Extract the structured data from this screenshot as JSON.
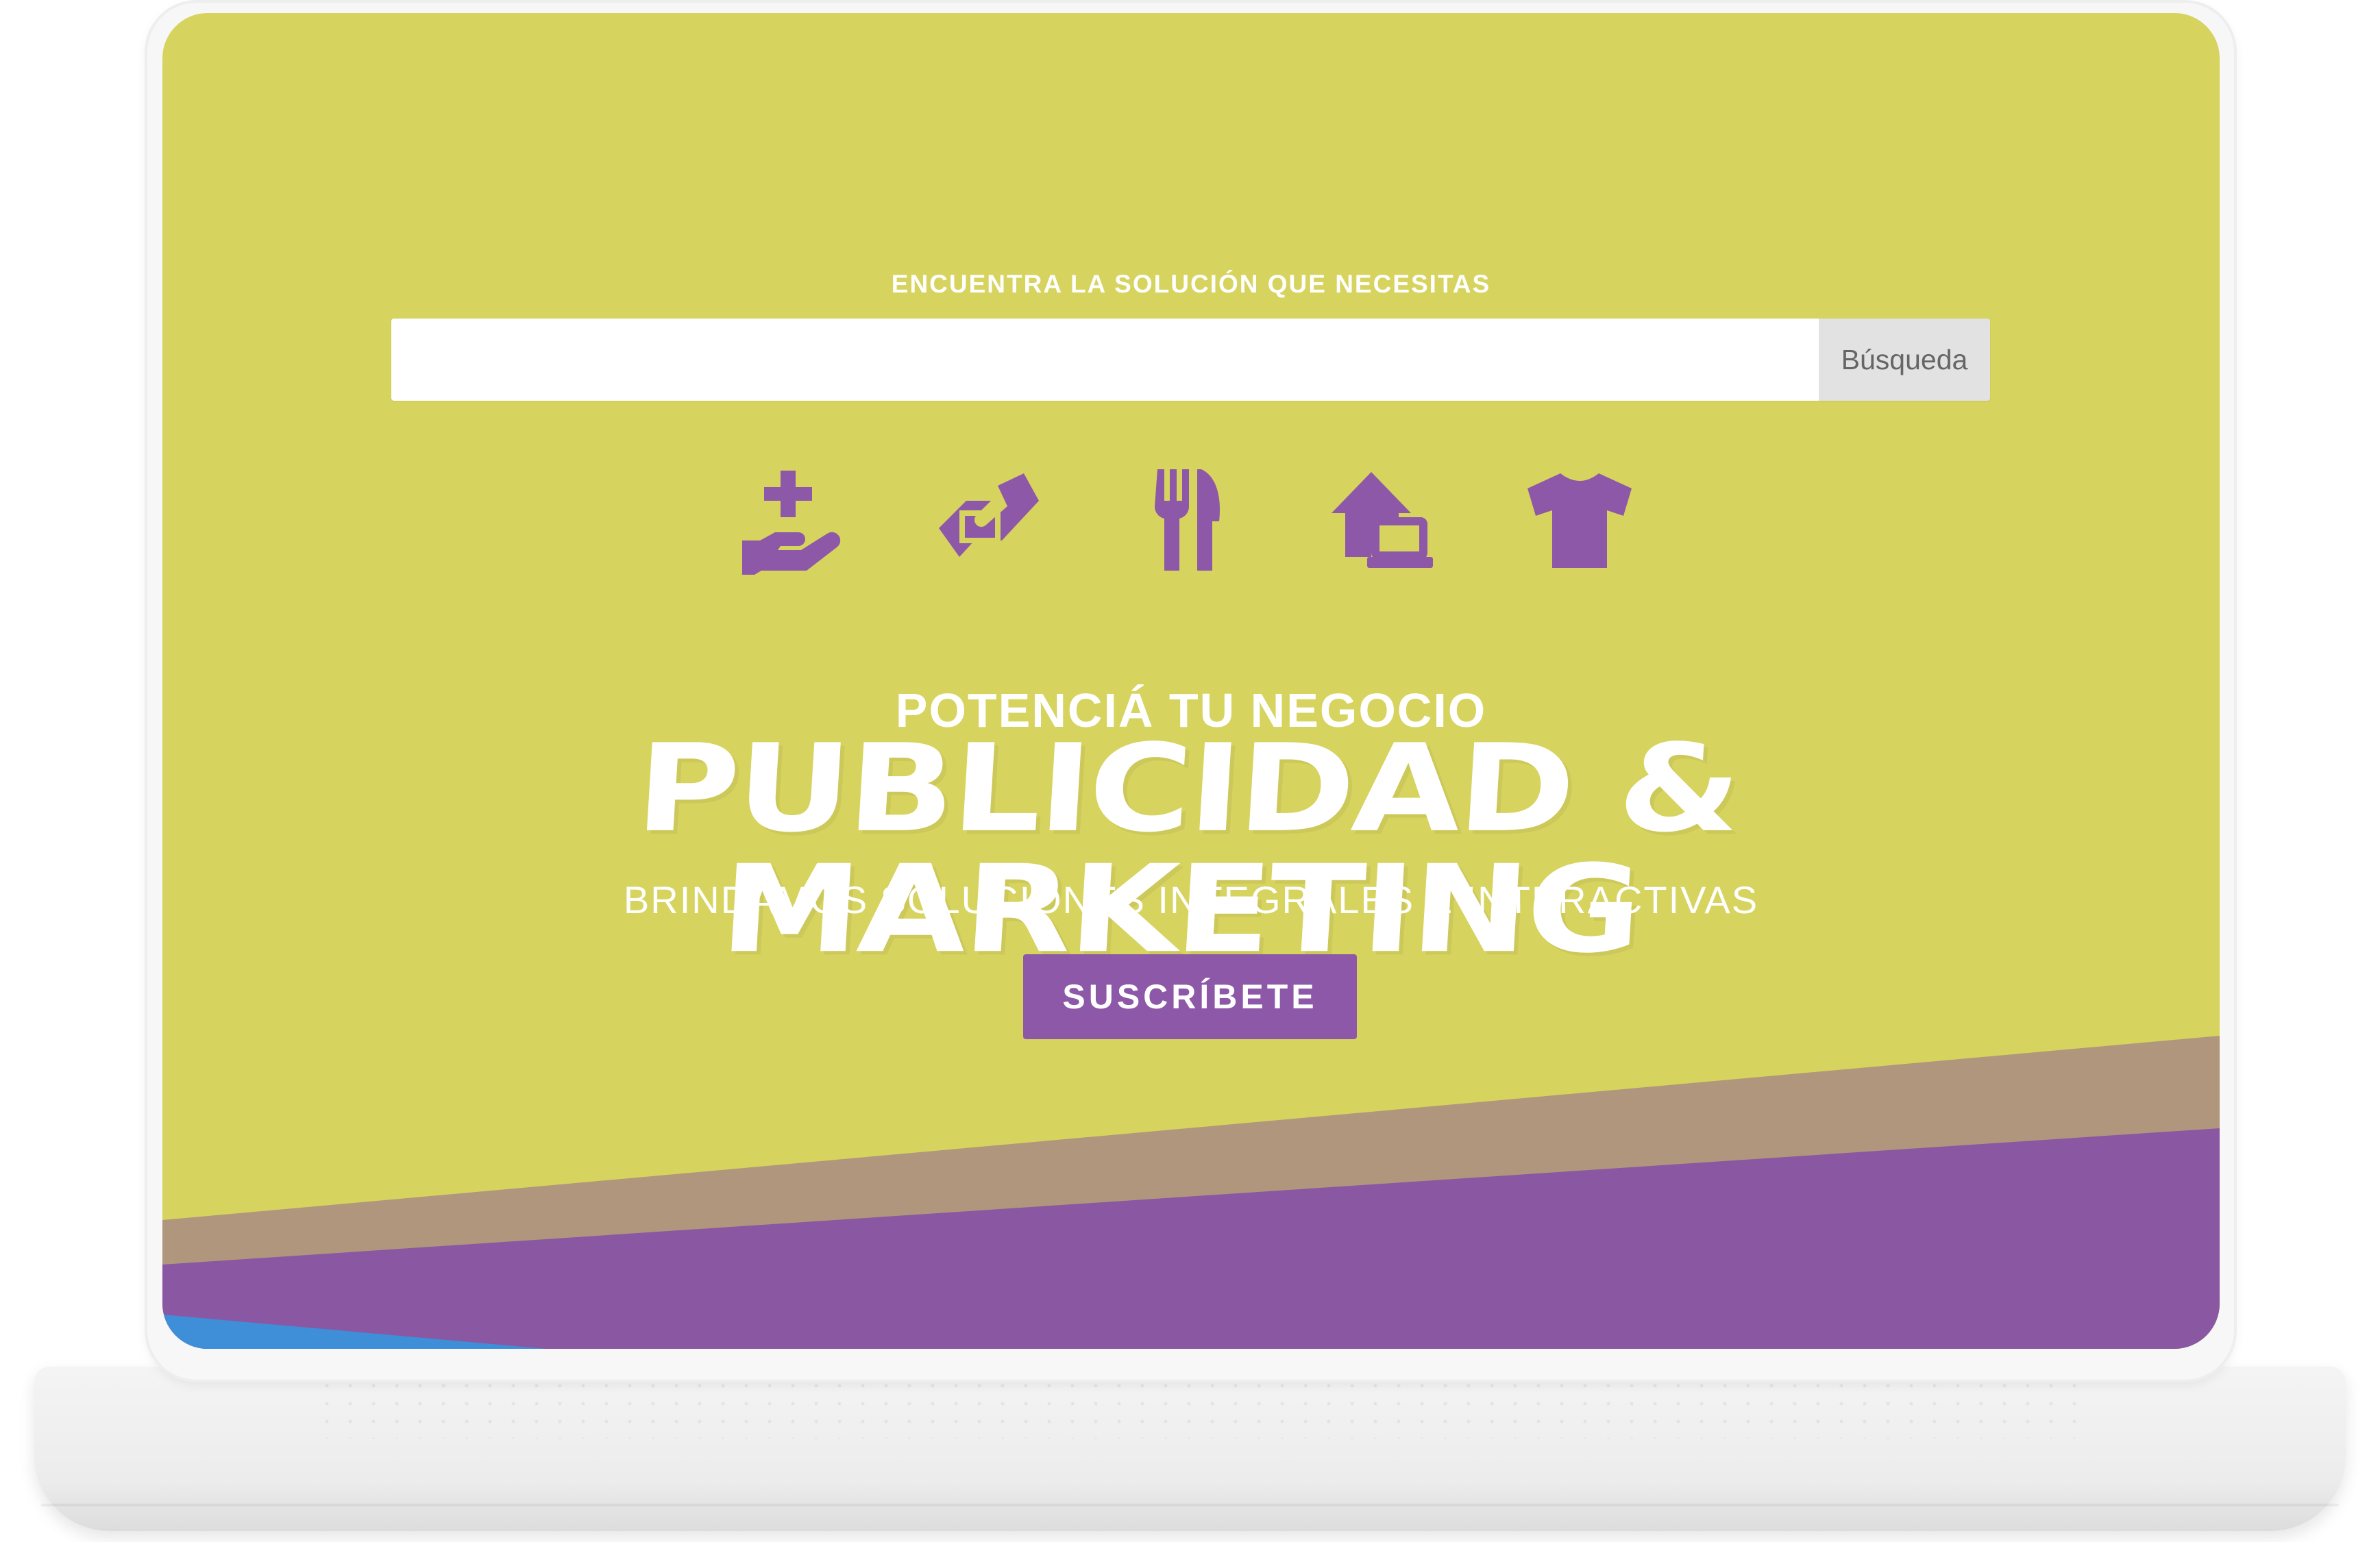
{
  "search": {
    "label": "ENCUENTRA LA SOLUCIÓN QUE NECESITAS",
    "input_value": "",
    "placeholder": "",
    "button_label": "Búsqueda"
  },
  "categories": [
    {
      "icon": "hand-holding-medical-icon"
    },
    {
      "icon": "handshake-icon"
    },
    {
      "icon": "utensils-icon"
    },
    {
      "icon": "home-laptop-icon"
    },
    {
      "icon": "tshirt-icon"
    }
  ],
  "hero": {
    "kicker": "POTENCIÁ TU NEGOCIO",
    "headline": "PUBLICIDAD & MARKETING",
    "subtitle": "BRINDAMOS SOLUCIONES INTEGRALES E INTERACTIVAS",
    "cta_label": "SUSCRÍBETE"
  },
  "colors": {
    "background": "#d7d35f",
    "accent": "#8e58a8",
    "band": "#b0967d",
    "text": "#ffffff"
  }
}
